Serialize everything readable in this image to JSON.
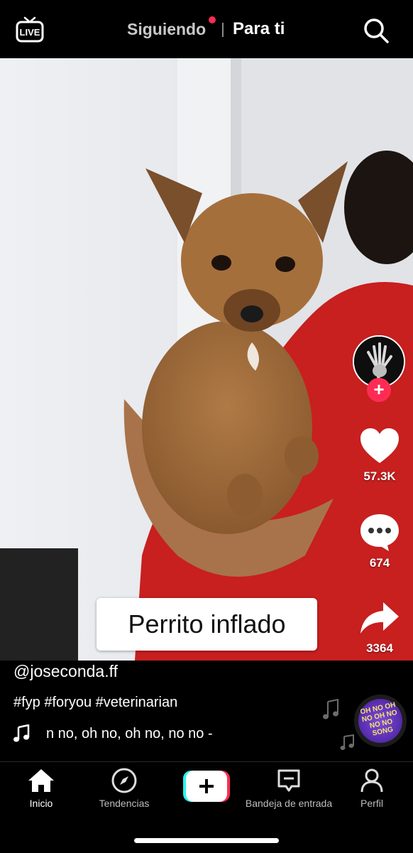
{
  "header": {
    "live_label": "LIVE",
    "tab_following": "Siguiendo",
    "tab_foryou": "Para ti",
    "notification_dot_color": "#fe2c55"
  },
  "video": {
    "caption_sticker": "Perrito inflado"
  },
  "actions": {
    "likes": "57.3K",
    "comments": "674",
    "shares": "3364"
  },
  "post": {
    "username": "@joseconda.ff",
    "hashtags": "#fyp #foryou #veterinarian",
    "music_scroll_text": "n no, oh no, oh no, no no -",
    "disc_text": "OH NO OH NO OH NO NO NO SONG"
  },
  "nav": {
    "home": "Inicio",
    "discover": "Tendencias",
    "inbox": "Bandeja de entrada",
    "profile": "Perfil"
  },
  "colors": {
    "accent": "#fe2c55",
    "cyan": "#25f4ee"
  },
  "icons": [
    "live-icon",
    "search-icon",
    "heart-icon",
    "comment-icon",
    "share-icon",
    "music-note-icon",
    "home-icon",
    "compass-icon",
    "plus-icon",
    "inbox-icon",
    "profile-icon"
  ]
}
